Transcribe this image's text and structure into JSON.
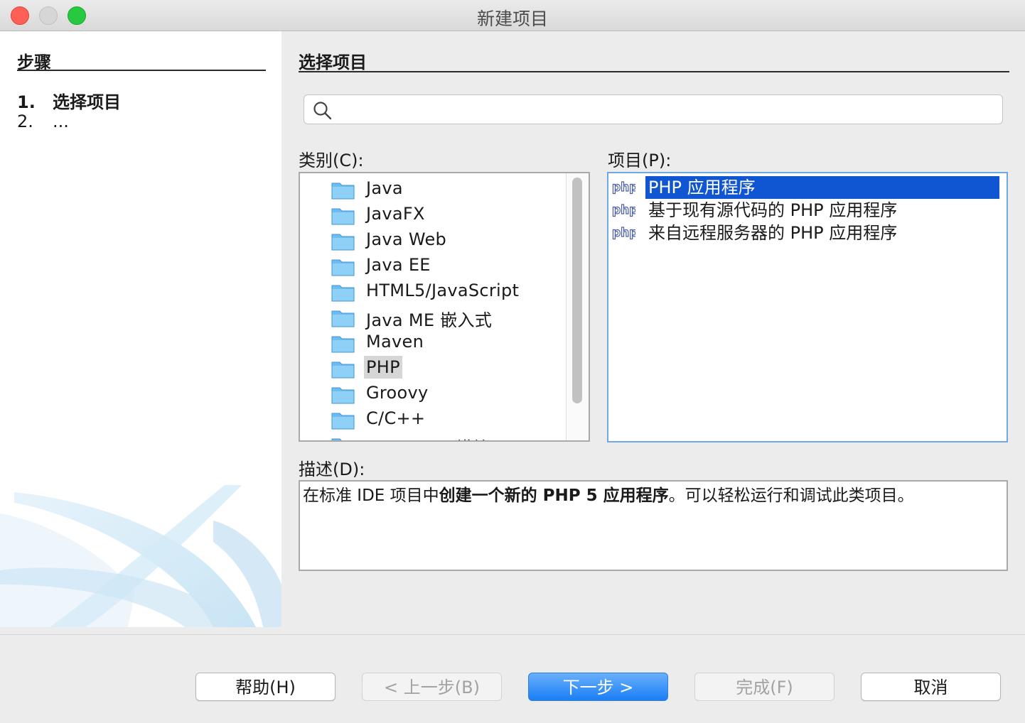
{
  "window": {
    "title": "新建项目"
  },
  "steps": {
    "heading": "步骤",
    "items": [
      {
        "num": "1.",
        "label": "选择项目"
      },
      {
        "num": "2.",
        "label": "..."
      }
    ]
  },
  "main": {
    "heading": "选择项目",
    "search": {
      "value": "",
      "placeholder": ""
    }
  },
  "categories": {
    "label": "类别(C):",
    "items": [
      "Java",
      "JavaFX",
      "Java Web",
      "Java EE",
      "HTML5/JavaScript",
      "Java ME 嵌入式",
      "Maven",
      "PHP",
      "Groovy",
      "C/C++",
      "NetBeans 模块"
    ],
    "selected": "PHP"
  },
  "projects": {
    "label": "项目(P):",
    "items": [
      "PHP 应用程序",
      "基于现有源代码的 PHP 应用程序",
      "来自远程服务器的 PHP 应用程序"
    ],
    "selected": "PHP 应用程序",
    "icon_text": "php"
  },
  "description": {
    "label": "描述(D):",
    "text_before": "在标准 IDE 项目中",
    "text_bold": "创建一个新的 PHP 5 应用程序",
    "text_after": "。可以轻松运行和调试此类项目。"
  },
  "buttons": {
    "help": "帮助(H)",
    "back": "< 上一步(B)",
    "next": "下一步 >",
    "finish": "完成(F)",
    "cancel": "取消"
  },
  "colors": {
    "selection": "#1055d1",
    "primary_button": "#1a7ef5",
    "folder": "#7cc4f4",
    "close_light": "#fe5f57",
    "max_light": "#28c840"
  },
  "icons": {
    "search": "search-icon",
    "folder": "folder-icon",
    "php": "php-file-icon"
  }
}
